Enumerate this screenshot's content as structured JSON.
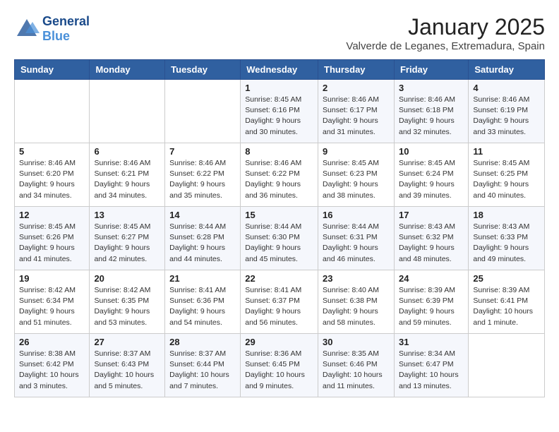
{
  "header": {
    "logo_general": "General",
    "logo_blue": "Blue",
    "month": "January 2025",
    "location": "Valverde de Leganes, Extremadura, Spain"
  },
  "weekdays": [
    "Sunday",
    "Monday",
    "Tuesday",
    "Wednesday",
    "Thursday",
    "Friday",
    "Saturday"
  ],
  "weeks": [
    [
      {
        "day": "",
        "info": ""
      },
      {
        "day": "",
        "info": ""
      },
      {
        "day": "",
        "info": ""
      },
      {
        "day": "1",
        "info": "Sunrise: 8:45 AM\nSunset: 6:16 PM\nDaylight: 9 hours and 30 minutes."
      },
      {
        "day": "2",
        "info": "Sunrise: 8:46 AM\nSunset: 6:17 PM\nDaylight: 9 hours and 31 minutes."
      },
      {
        "day": "3",
        "info": "Sunrise: 8:46 AM\nSunset: 6:18 PM\nDaylight: 9 hours and 32 minutes."
      },
      {
        "day": "4",
        "info": "Sunrise: 8:46 AM\nSunset: 6:19 PM\nDaylight: 9 hours and 33 minutes."
      }
    ],
    [
      {
        "day": "5",
        "info": "Sunrise: 8:46 AM\nSunset: 6:20 PM\nDaylight: 9 hours and 34 minutes."
      },
      {
        "day": "6",
        "info": "Sunrise: 8:46 AM\nSunset: 6:21 PM\nDaylight: 9 hours and 34 minutes."
      },
      {
        "day": "7",
        "info": "Sunrise: 8:46 AM\nSunset: 6:22 PM\nDaylight: 9 hours and 35 minutes."
      },
      {
        "day": "8",
        "info": "Sunrise: 8:46 AM\nSunset: 6:22 PM\nDaylight: 9 hours and 36 minutes."
      },
      {
        "day": "9",
        "info": "Sunrise: 8:45 AM\nSunset: 6:23 PM\nDaylight: 9 hours and 38 minutes."
      },
      {
        "day": "10",
        "info": "Sunrise: 8:45 AM\nSunset: 6:24 PM\nDaylight: 9 hours and 39 minutes."
      },
      {
        "day": "11",
        "info": "Sunrise: 8:45 AM\nSunset: 6:25 PM\nDaylight: 9 hours and 40 minutes."
      }
    ],
    [
      {
        "day": "12",
        "info": "Sunrise: 8:45 AM\nSunset: 6:26 PM\nDaylight: 9 hours and 41 minutes."
      },
      {
        "day": "13",
        "info": "Sunrise: 8:45 AM\nSunset: 6:27 PM\nDaylight: 9 hours and 42 minutes."
      },
      {
        "day": "14",
        "info": "Sunrise: 8:44 AM\nSunset: 6:28 PM\nDaylight: 9 hours and 44 minutes."
      },
      {
        "day": "15",
        "info": "Sunrise: 8:44 AM\nSunset: 6:30 PM\nDaylight: 9 hours and 45 minutes."
      },
      {
        "day": "16",
        "info": "Sunrise: 8:44 AM\nSunset: 6:31 PM\nDaylight: 9 hours and 46 minutes."
      },
      {
        "day": "17",
        "info": "Sunrise: 8:43 AM\nSunset: 6:32 PM\nDaylight: 9 hours and 48 minutes."
      },
      {
        "day": "18",
        "info": "Sunrise: 8:43 AM\nSunset: 6:33 PM\nDaylight: 9 hours and 49 minutes."
      }
    ],
    [
      {
        "day": "19",
        "info": "Sunrise: 8:42 AM\nSunset: 6:34 PM\nDaylight: 9 hours and 51 minutes."
      },
      {
        "day": "20",
        "info": "Sunrise: 8:42 AM\nSunset: 6:35 PM\nDaylight: 9 hours and 53 minutes."
      },
      {
        "day": "21",
        "info": "Sunrise: 8:41 AM\nSunset: 6:36 PM\nDaylight: 9 hours and 54 minutes."
      },
      {
        "day": "22",
        "info": "Sunrise: 8:41 AM\nSunset: 6:37 PM\nDaylight: 9 hours and 56 minutes."
      },
      {
        "day": "23",
        "info": "Sunrise: 8:40 AM\nSunset: 6:38 PM\nDaylight: 9 hours and 58 minutes."
      },
      {
        "day": "24",
        "info": "Sunrise: 8:39 AM\nSunset: 6:39 PM\nDaylight: 9 hours and 59 minutes."
      },
      {
        "day": "25",
        "info": "Sunrise: 8:39 AM\nSunset: 6:41 PM\nDaylight: 10 hours and 1 minute."
      }
    ],
    [
      {
        "day": "26",
        "info": "Sunrise: 8:38 AM\nSunset: 6:42 PM\nDaylight: 10 hours and 3 minutes."
      },
      {
        "day": "27",
        "info": "Sunrise: 8:37 AM\nSunset: 6:43 PM\nDaylight: 10 hours and 5 minutes."
      },
      {
        "day": "28",
        "info": "Sunrise: 8:37 AM\nSunset: 6:44 PM\nDaylight: 10 hours and 7 minutes."
      },
      {
        "day": "29",
        "info": "Sunrise: 8:36 AM\nSunset: 6:45 PM\nDaylight: 10 hours and 9 minutes."
      },
      {
        "day": "30",
        "info": "Sunrise: 8:35 AM\nSunset: 6:46 PM\nDaylight: 10 hours and 11 minutes."
      },
      {
        "day": "31",
        "info": "Sunrise: 8:34 AM\nSunset: 6:47 PM\nDaylight: 10 hours and 13 minutes."
      },
      {
        "day": "",
        "info": ""
      }
    ]
  ]
}
